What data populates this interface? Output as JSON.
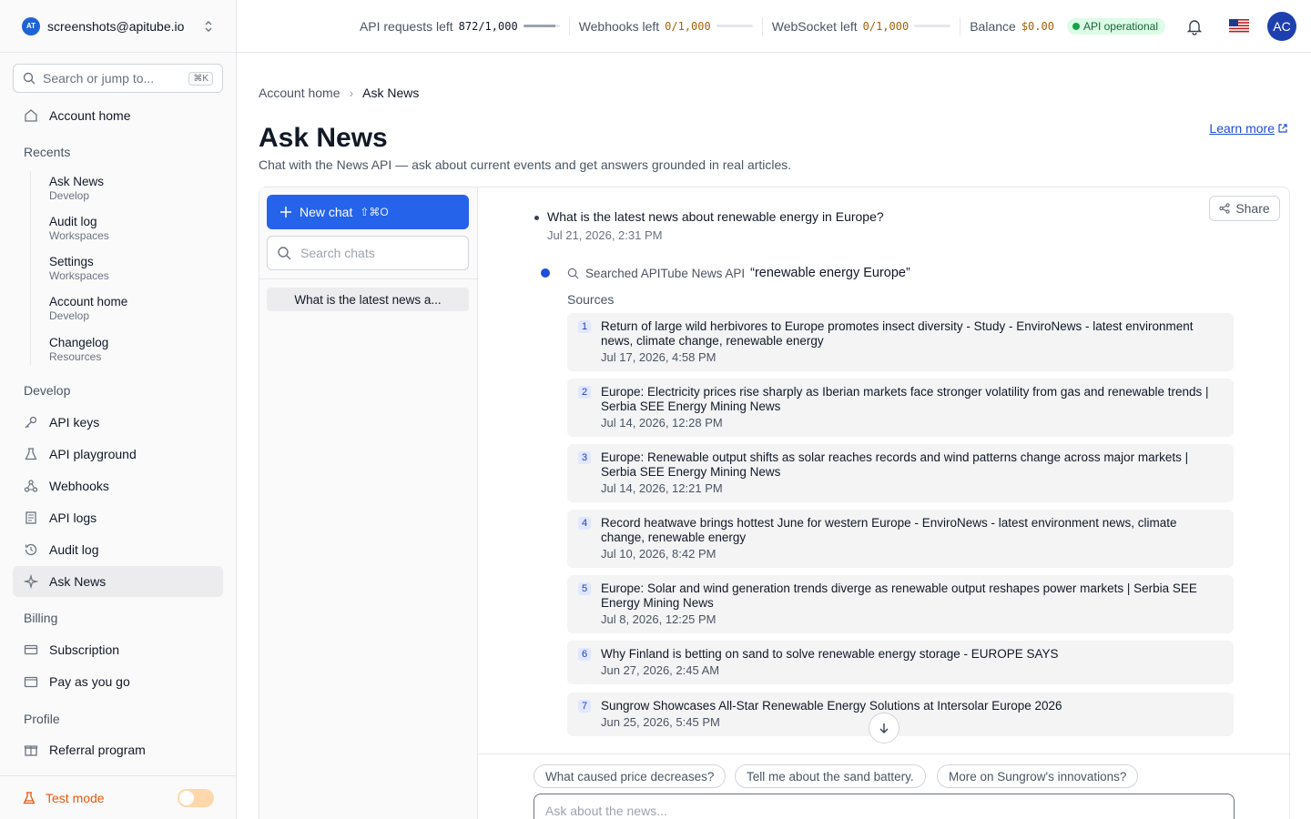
{
  "account": {
    "email": "screenshots@apitube.io",
    "logo_text": "AT"
  },
  "search": {
    "placeholder": "Search or jump to...",
    "shortcut": "⌘K"
  },
  "sidebar": {
    "account_home": "Account home",
    "recents_title": "Recents",
    "recents": [
      {
        "title": "Ask News",
        "section": "Develop"
      },
      {
        "title": "Audit log",
        "section": "Workspaces"
      },
      {
        "title": "Settings",
        "section": "Workspaces"
      },
      {
        "title": "Account home",
        "section": "Develop"
      },
      {
        "title": "Changelog",
        "section": "Resources"
      }
    ],
    "develop_title": "Develop",
    "develop": [
      "API keys",
      "API playground",
      "Webhooks",
      "API logs",
      "Audit log",
      "Ask News"
    ],
    "billing_title": "Billing",
    "billing": [
      "Subscription",
      "Pay as you go"
    ],
    "profile_title": "Profile",
    "profile": [
      "Referral program"
    ],
    "test_mode": "Test mode"
  },
  "topbar": {
    "api_requests_label": "API requests left",
    "api_requests_value": "872/1,000",
    "api_requests_fraction": 0.872,
    "webhooks_label": "Webhooks left",
    "webhooks_value": "0/1,000",
    "webhooks_fraction": 0,
    "websocket_label": "WebSocket left",
    "websocket_value": "0/1,000",
    "websocket_fraction": 0,
    "balance_label": "Balance",
    "balance_value": "$0.00",
    "status": "API operational",
    "avatar_initials": "AC"
  },
  "breadcrumb": {
    "parent": "Account home",
    "current": "Ask News"
  },
  "page": {
    "title": "Ask News",
    "subtitle": "Chat with the News API — ask about current events and get answers grounded in real articles.",
    "learn_more": "Learn more"
  },
  "chat_list": {
    "new_chat": "New chat",
    "new_chat_shortcut": "⇧⌘O",
    "search_placeholder": "Search chats",
    "items": [
      "What is the latest news a..."
    ]
  },
  "conversation": {
    "share": "Share",
    "question": "What is the latest news about renewable energy in Europe?",
    "question_time": "Jul 21, 2026, 2:31 PM",
    "search_label": "Searched APITube News API",
    "search_query": "“renewable energy Europe”",
    "sources_title": "Sources",
    "sources": [
      {
        "num": "1",
        "title": "Return of large wild herbivores to Europe promotes insect diversity - Study - EnviroNews - latest environment news, climate change, renewable energy",
        "date": "Jul 17, 2026, 4:58 PM"
      },
      {
        "num": "2",
        "title": "Europe: Electricity prices rise sharply as Iberian markets face stronger volatility from gas and renewable trends | Serbia SEE Energy Mining News",
        "date": "Jul 14, 2026, 12:28 PM"
      },
      {
        "num": "3",
        "title": "Europe: Renewable output shifts as solar reaches records and wind patterns change across major markets | Serbia SEE Energy Mining News",
        "date": "Jul 14, 2026, 12:21 PM"
      },
      {
        "num": "4",
        "title": "Record heatwave brings hottest June for western Europe - EnviroNews - latest environment news, climate change, renewable energy",
        "date": "Jul 10, 2026, 8:42 PM"
      },
      {
        "num": "5",
        "title": "Europe: Solar and wind generation trends diverge as renewable output reshapes power markets | Serbia SEE Energy Mining News",
        "date": "Jul 8, 2026, 12:25 PM"
      },
      {
        "num": "6",
        "title": "Why Finland is betting on sand to solve renewable energy storage - EUROPE SAYS",
        "date": "Jun 27, 2026, 2:45 AM"
      },
      {
        "num": "7",
        "title": "Sungrow Showcases All-Star Renewable Energy Solutions at Intersolar Europe 2026",
        "date": "Jun 25, 2026, 5:45 PM"
      }
    ],
    "suggestions": [
      "What caused price decreases?",
      "Tell me about the sand battery.",
      "More on Sungrow's innovations?"
    ],
    "input_placeholder": "Ask about the news..."
  },
  "colors": {
    "primary": "#2563eb",
    "status_green": "#16a34a",
    "warning": "#ea580c"
  }
}
